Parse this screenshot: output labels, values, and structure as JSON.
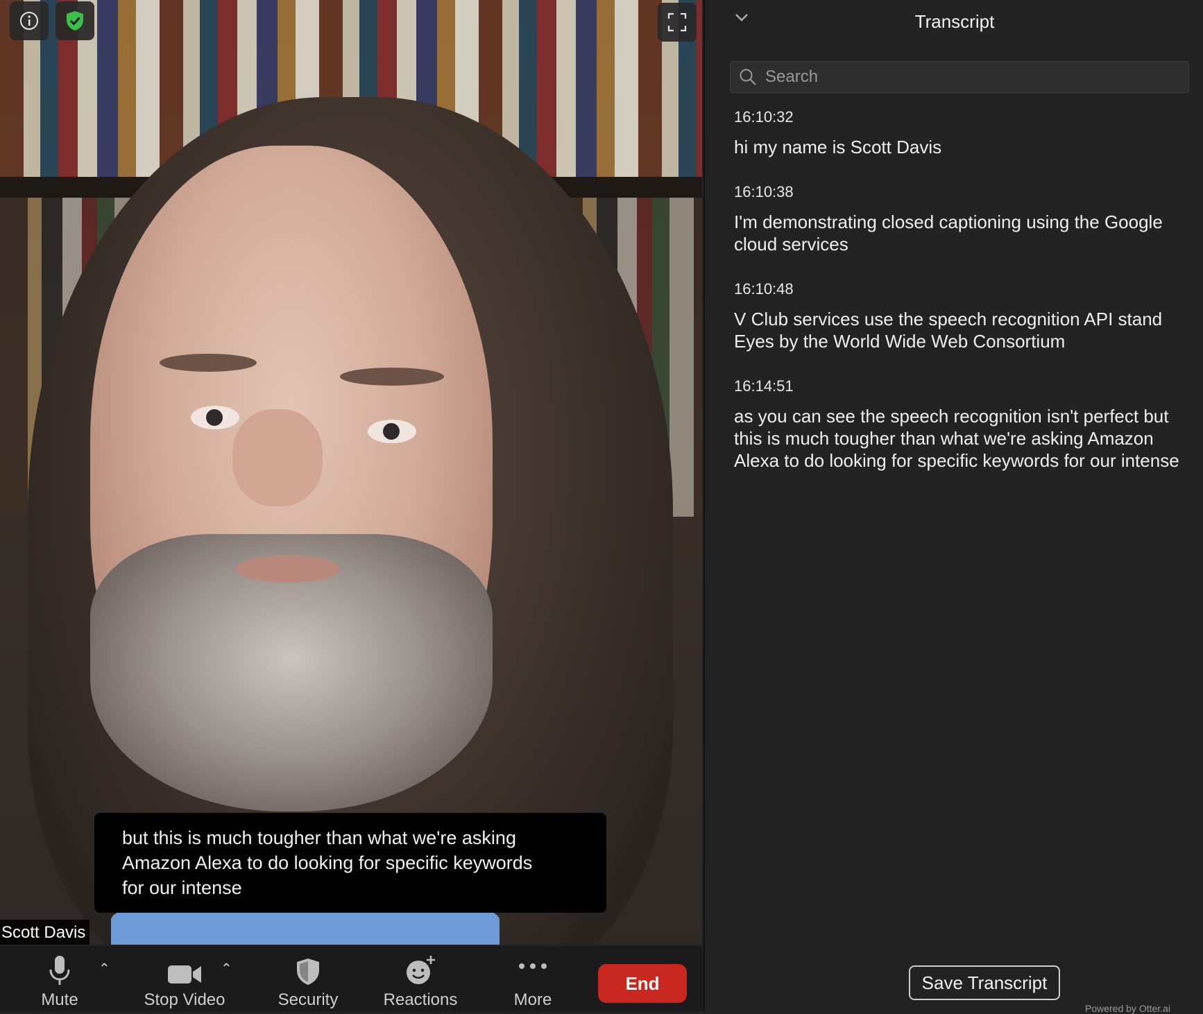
{
  "video": {
    "participant_name": "Scott Davis",
    "caption_lines": [
      "but this is much tougher than what we're asking",
      "Amazon Alexa to do looking for specific keywords",
      "for our intense"
    ],
    "icons": {
      "info": "info-icon",
      "security_badge": "shield-check-icon",
      "fullscreen": "fullscreen-icon"
    }
  },
  "toolbar": {
    "mute_label": "Mute",
    "stop_video_label": "Stop Video",
    "security_label": "Security",
    "reactions_label": "Reactions",
    "more_label": "More",
    "end_label": "End"
  },
  "transcript": {
    "title": "Transcript",
    "search_placeholder": "Search",
    "entries": [
      {
        "time": "16:10:32",
        "text": "hi my name is Scott Davis"
      },
      {
        "time": "16:10:38",
        "text": "I'm demonstrating closed captioning using the Google cloud services"
      },
      {
        "time": "16:10:48",
        "text": "V Club services use the speech recognition API stand Eyes by the World Wide Web Consortium"
      },
      {
        "time": "16:14:51",
        "text": "as you can see the speech recognition isn't perfect but this is much tougher than what we're asking Amazon Alexa to do looking for specific keywords for our intense"
      }
    ],
    "save_label": "Save Transcript",
    "powered_by": "Powered by Otter.ai"
  },
  "colors": {
    "end_button": "#c8281f",
    "security_badge": "#3cc04c",
    "panel_bg": "#232323"
  }
}
